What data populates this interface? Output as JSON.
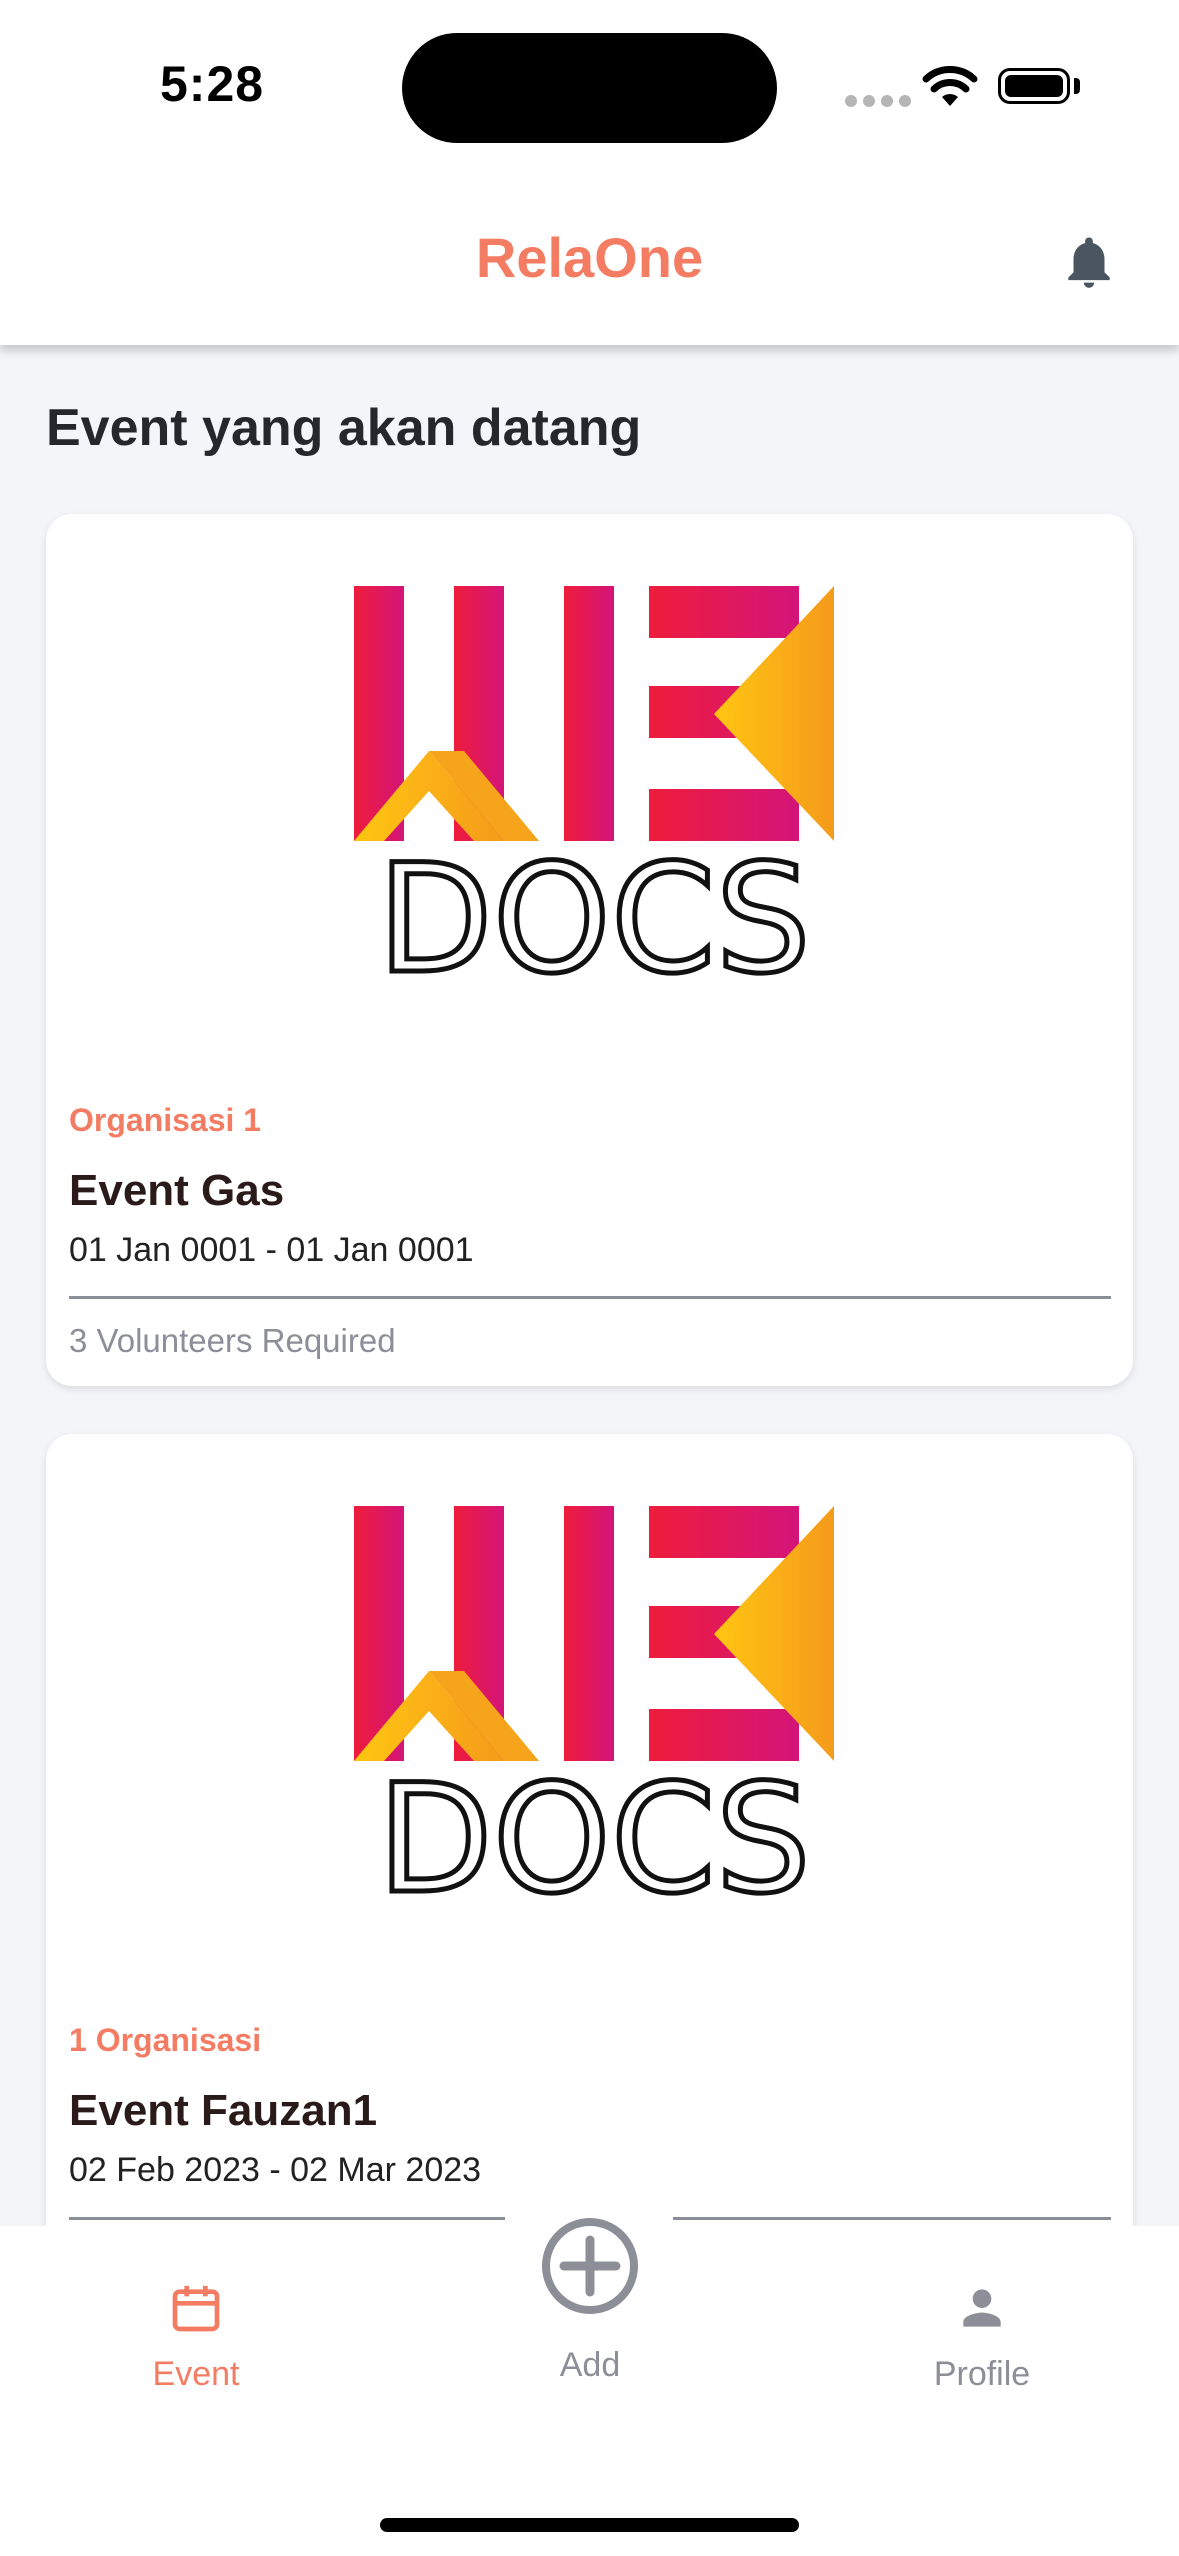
{
  "status_bar": {
    "time": "5:28"
  },
  "app": {
    "title": "RelaOne"
  },
  "section_title": "Event yang akan datang",
  "events": [
    {
      "organization": "Organisasi 1",
      "name": "Event Gas",
      "dates": "01 Jan 0001 - 01 Jan 0001",
      "volunteers": "3 Volunteers Required",
      "logo_text": "DOCS"
    },
    {
      "organization": "1 Organisasi",
      "name": "Event Fauzan1",
      "dates": "02 Feb 2023 - 02 Mar 2023",
      "logo_text": "DOCS"
    }
  ],
  "nav": {
    "event_label": "Event",
    "add_label": "Add",
    "profile_label": "Profile",
    "active_color": "#f47c62",
    "inactive_color": "#8c8f97"
  },
  "icons": [
    "bell-icon",
    "calendar-icon",
    "plus-circle-icon",
    "person-icon",
    "wifi-icon",
    "battery-icon"
  ]
}
